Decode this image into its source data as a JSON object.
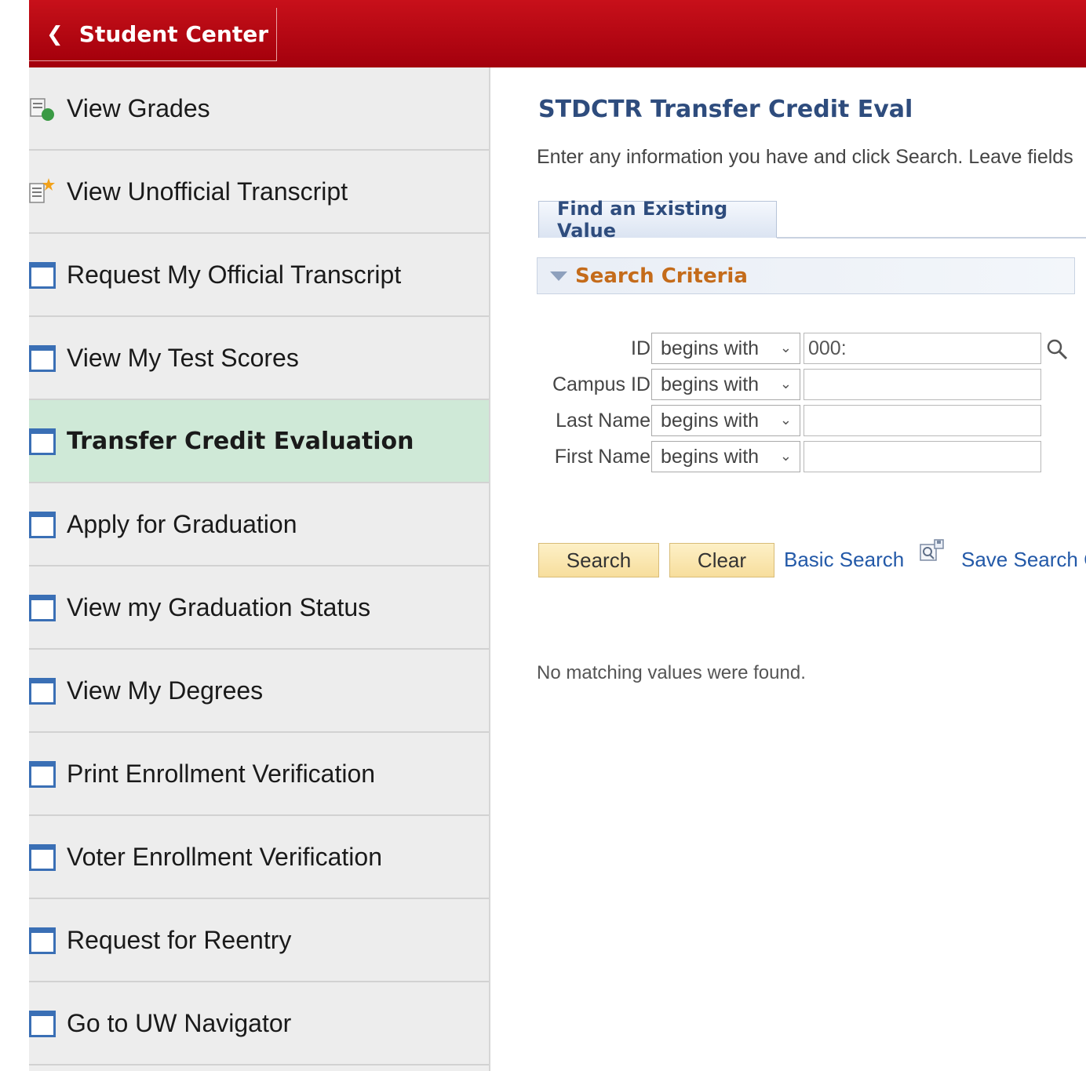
{
  "header": {
    "back_label": "Student Center",
    "accent_color": "#b8000f"
  },
  "sidebar": {
    "items": [
      {
        "label": "View Grades",
        "icon": "grades-icon",
        "active": false
      },
      {
        "label": "View Unofficial Transcript",
        "icon": "transcript-icon",
        "active": false
      },
      {
        "label": "Request My Official Transcript",
        "icon": "window-icon",
        "active": false
      },
      {
        "label": "View My Test Scores",
        "icon": "window-icon",
        "active": false
      },
      {
        "label": "Transfer Credit Evaluation",
        "icon": "window-icon",
        "active": true
      },
      {
        "label": "Apply for Graduation",
        "icon": "window-icon",
        "active": false
      },
      {
        "label": "View my Graduation Status",
        "icon": "window-icon",
        "active": false
      },
      {
        "label": "View My Degrees",
        "icon": "window-icon",
        "active": false
      },
      {
        "label": "Print Enrollment Verification",
        "icon": "window-icon",
        "active": false
      },
      {
        "label": "Voter Enrollment Verification",
        "icon": "window-icon",
        "active": false
      },
      {
        "label": "Request for Reentry",
        "icon": "window-icon",
        "active": false
      },
      {
        "label": "Go to UW Navigator",
        "icon": "window-icon",
        "active": false
      }
    ]
  },
  "main": {
    "title": "STDCTR Transfer Credit Eval",
    "instructions": "Enter any information you have and click Search. Leave fields",
    "tab_label": "Find an Existing Value",
    "criteria_label": "Search Criteria",
    "fields": [
      {
        "label": "ID",
        "operator": "begins with",
        "value": "000:",
        "has_lookup": true
      },
      {
        "label": "Campus ID",
        "operator": "begins with",
        "value": ""
      },
      {
        "label": "Last Name",
        "operator": "begins with",
        "value": ""
      },
      {
        "label": "First Name",
        "operator": "begins with",
        "value": ""
      }
    ],
    "search_button": "Search",
    "clear_button": "Clear",
    "basic_search_link": "Basic Search",
    "save_search_link": "Save Search C",
    "no_results": "No matching values were found."
  }
}
